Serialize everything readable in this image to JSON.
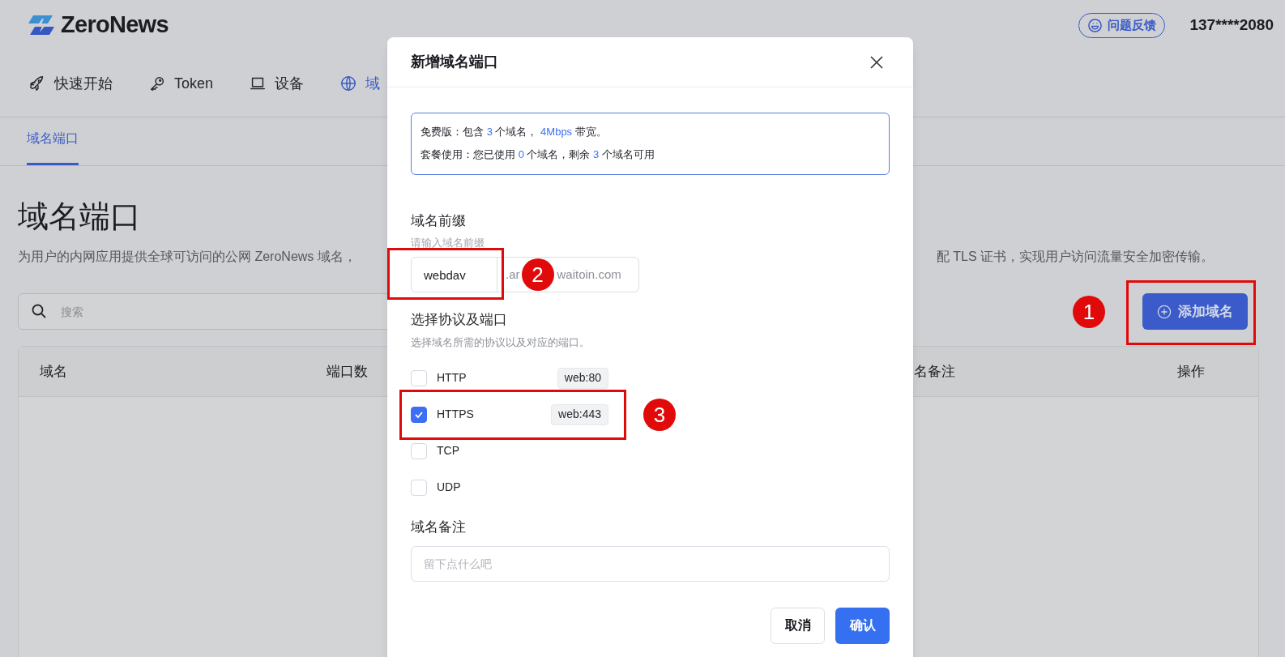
{
  "header": {
    "logo": "ZeroNews",
    "feedback": "问题反馈",
    "user": "137****2080"
  },
  "nav": [
    {
      "label": "快速开始",
      "selected": false
    },
    {
      "label": "Token",
      "selected": false
    },
    {
      "label": "设备",
      "selected": false
    },
    {
      "label": "域",
      "selected": true
    }
  ],
  "subtabs": [
    {
      "label": "域名端口",
      "selected": true
    }
  ],
  "page": {
    "title": "域名端口",
    "description_left": "为用户的内网应用提供全球可访问的公网 ZeroNews 域名，",
    "description_right": "配 TLS 证书，实现用户访问流量安全加密传输。"
  },
  "search": {
    "placeholder": "搜索"
  },
  "add_button": {
    "label": "添加域名",
    "step": "1"
  },
  "table": {
    "columns": [
      "域名",
      "端口数",
      "名备注",
      "操作"
    ]
  },
  "dialog": {
    "title": "新增域名端口",
    "info": [
      [
        {
          "text": "免费版：包含 ",
          "highlight": false
        },
        {
          "text": "3",
          "highlight": true
        },
        {
          "text": " 个域名， ",
          "highlight": false
        },
        {
          "text": "4Mbps",
          "highlight": true
        },
        {
          "text": " 带宽。",
          "highlight": false
        }
      ],
      [
        {
          "text": "套餐使用：您已使用 ",
          "highlight": false
        },
        {
          "text": "0",
          "highlight": true
        },
        {
          "text": " 个域名，剩余 ",
          "highlight": false
        },
        {
          "text": "3",
          "highlight": true
        },
        {
          "text": " 个域名可用",
          "highlight": false
        }
      ]
    ],
    "prefix": {
      "label": "域名前缀",
      "hint": "请输入域名前缀",
      "value": "webdav",
      "suffix_start": ".ar",
      "suffix_end": "waitoin.com",
      "step": "2"
    },
    "protocol": {
      "label": "选择协议及端口",
      "hint": "选择域名所需的协议以及对应的端口。",
      "options": [
        {
          "label": "HTTP",
          "checked": false,
          "port": "web:80"
        },
        {
          "label": "HTTPS",
          "checked": true,
          "port": "web:443",
          "step": "3"
        },
        {
          "label": "TCP",
          "checked": false
        },
        {
          "label": "UDP",
          "checked": false
        }
      ]
    },
    "note": {
      "label": "域名备注",
      "placeholder": "留下点什么吧"
    },
    "buttons": [
      {
        "label": "取消",
        "kind": "secondary"
      },
      {
        "label": "确认",
        "kind": "primary"
      }
    ]
  }
}
